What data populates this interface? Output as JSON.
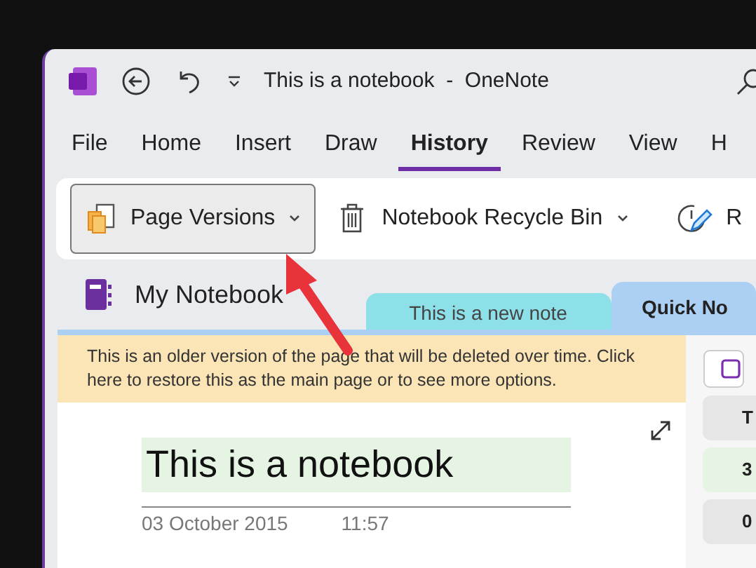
{
  "window": {
    "title": "This is a notebook  -  OneNote"
  },
  "menu_tabs": [
    {
      "label": "File",
      "selected": false
    },
    {
      "label": "Home",
      "selected": false
    },
    {
      "label": "Insert",
      "selected": false
    },
    {
      "label": "Draw",
      "selected": false
    },
    {
      "label": "History",
      "selected": true
    },
    {
      "label": "Review",
      "selected": false
    },
    {
      "label": "View",
      "selected": false
    },
    {
      "label": "H",
      "selected": false
    }
  ],
  "ribbon": {
    "items": [
      {
        "kind": "versions",
        "label": "Page Versions",
        "dropdown": true,
        "selected": true
      },
      {
        "kind": "recycle",
        "label": "Notebook Recycle Bin",
        "dropdown": true,
        "selected": false
      },
      {
        "kind": "pen",
        "label": "R",
        "dropdown": false,
        "selected": false
      }
    ]
  },
  "notebook": {
    "name": "My Notebook"
  },
  "section_tabs": [
    {
      "label": "This is a new note",
      "color": "#8ee0e8",
      "selected": false
    },
    {
      "label": "Quick No",
      "color": "#acd0f4",
      "selected": true
    }
  ],
  "banner": {
    "text": "This is an older version of the page that will be deleted over time. Click here to restore this as the main page or to see more options."
  },
  "page": {
    "title": "This is a notebook",
    "date": "03 October 2015",
    "time": "11:57"
  },
  "page_list": {
    "items": [
      {
        "label": "T",
        "selected": false
      },
      {
        "label": "3",
        "selected": true
      },
      {
        "label": "0",
        "selected": false
      }
    ]
  }
}
